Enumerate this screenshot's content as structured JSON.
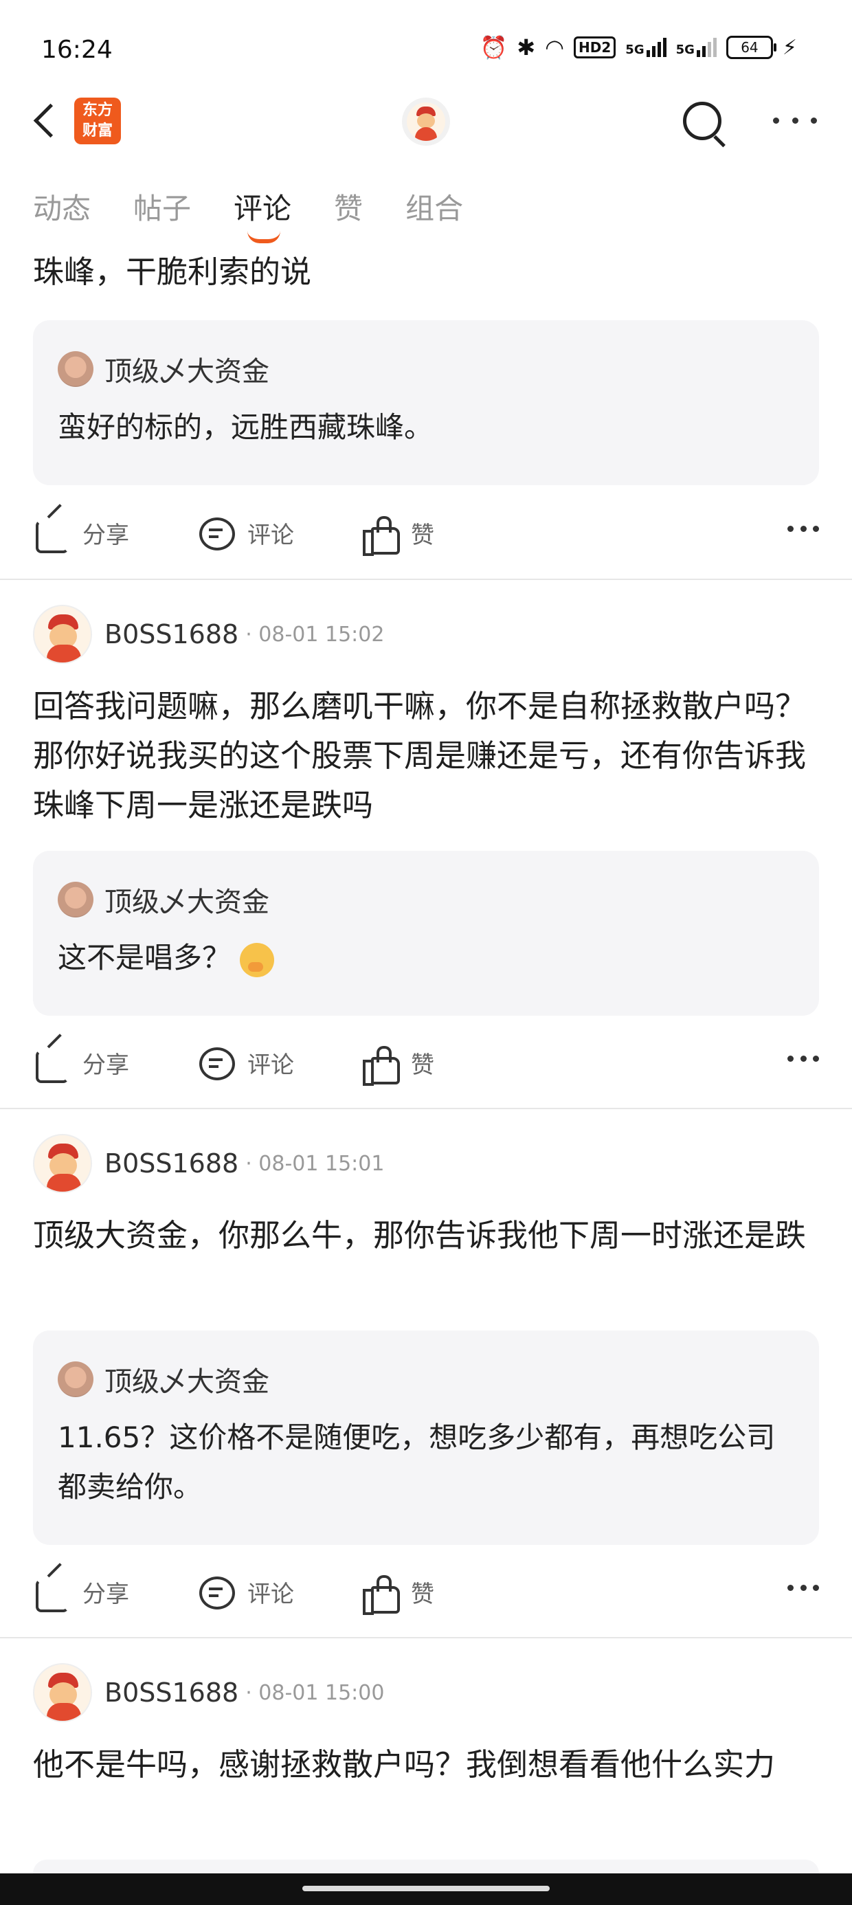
{
  "status_bar": {
    "time": "16:24",
    "hd_label": "HD2",
    "signal1_label": "5G",
    "signal2_label": "5G",
    "battery": "64"
  },
  "header": {
    "logo_text_line1": "东方",
    "logo_text_line2": "财富"
  },
  "tabs": [
    {
      "label": "动态"
    },
    {
      "label": "帖子"
    },
    {
      "label": "评论"
    },
    {
      "label": "赞"
    },
    {
      "label": "组合"
    }
  ],
  "active_tab": "评论",
  "colors": {
    "brand": "#ef5a1d",
    "quote_bg": "#f5f5f7"
  },
  "actions": {
    "share": "分享",
    "comment": "评论",
    "like": "赞"
  },
  "posts": [
    {
      "text": "珠峰，干脆利索的说",
      "quote_user": "顶级乄大资金",
      "quote_text": "蛮好的标的，远胜西藏珠峰。"
    },
    {
      "user": "B0SS1688",
      "meta": "· 08-01 15:02",
      "text": "回答我问题嘛，那么磨叽干嘛，你不是自称拯救散户吗？那你好说我买的这个股票下周是赚还是亏，还有你告诉我珠峰下周一是涨还是跌吗",
      "quote_user": "顶级乄大资金",
      "quote_text": "这不是唱多？"
    },
    {
      "user": "B0SS1688",
      "meta": "· 08-01 15:01",
      "text": "顶级大资金，你那么牛，那你告诉我他下周一时涨还是跌",
      "quote_user": "顶级乄大资金",
      "quote_text": "11.65？这价格不是随便吃，想吃多少都有，再想吃公司都卖给你。"
    },
    {
      "user": "B0SS1688",
      "meta": "· 08-01 15:00",
      "text": "他不是牛吗，感谢拯救散户吗？我倒想看看他什么实力"
    }
  ]
}
